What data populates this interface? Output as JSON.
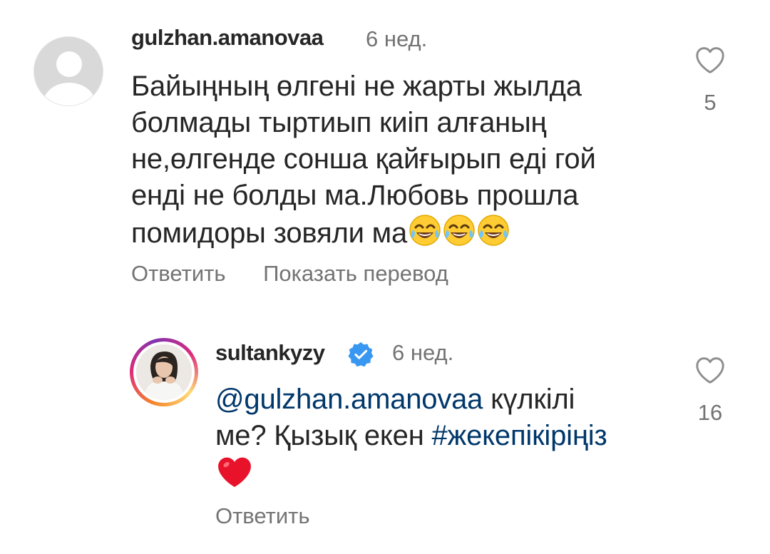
{
  "comments": [
    {
      "username": "gulzhan.amanovaa",
      "time": "6 нед.",
      "lines": [
        "Байыңның өлгені не жарты жылда",
        "болмады тыртиып киіп алғаның",
        "не,өлгенде сонша қайғырып еді гой",
        "енді не болды ма.Любовь прошла",
        "помидоры зовяли ма"
      ],
      "emojis": [
        "face-with-tears-of-joy",
        "face-with-tears-of-joy",
        "face-with-tears-of-joy"
      ],
      "reply_label": "Ответить",
      "translate_label": "Показать перевод",
      "likes": "5",
      "avatar": "default-avatar"
    },
    {
      "username": "sultankyzy",
      "verified": true,
      "time": "6 нед.",
      "mention": "@gulzhan.amanovaa",
      "line1_rest": " күлкілі",
      "line2_start": "ме? Қызық екен ",
      "hashtag": "#жекепікіріңіз",
      "emoji": "red-heart",
      "reply_label": "Ответить",
      "likes": "16",
      "avatar": "profile-photo"
    }
  ],
  "colors": {
    "text": "#262626",
    "secondary": "#737373",
    "link": "#00376b",
    "verified": "#3897f0",
    "heart": "#e0245e"
  }
}
